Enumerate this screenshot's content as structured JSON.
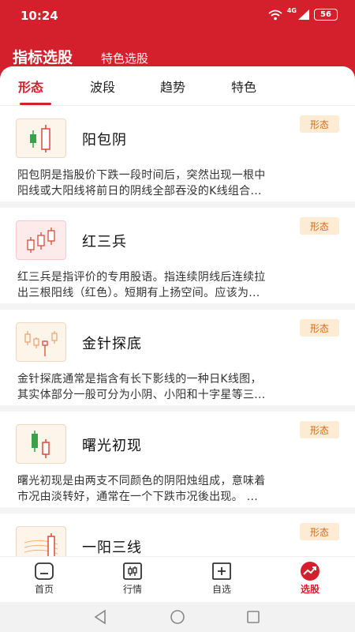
{
  "status": {
    "time": "10:24",
    "network": "4G",
    "battery": "56"
  },
  "top_nav": {
    "active": "指标选股",
    "other": "特色选股"
  },
  "tabs": [
    {
      "label": "形态"
    },
    {
      "label": "波段"
    },
    {
      "label": "趋势"
    },
    {
      "label": "特色"
    }
  ],
  "cards": [
    {
      "title": "阳包阴",
      "badge": "形态",
      "icon": "candlestick-bullish-engulfing-icon",
      "line1": "阳包阴是指股价下跌一段时间后，突然出现一根中",
      "line2": "阳线或大阳线将前日的阴线全部吞没的K线组合..."
    },
    {
      "title": "红三兵",
      "badge": "形态",
      "icon": "candlestick-three-soldiers-icon",
      "line1": "红三兵是指评价的专用股语。指连续阴线后连续拉",
      "line2": "出三根阳线（红色）。短期有上扬空间。应该为..."
    },
    {
      "title": "金针探底",
      "badge": "形态",
      "icon": "candlestick-hammer-icon",
      "line1": "金针探底通常是指含有长下影线的一种日K线图，",
      "line2": "其实体部分一般可分为小阴、小阳和十字星等三..."
    },
    {
      "title": "曙光初现",
      "badge": "形态",
      "icon": "candlestick-piercing-icon",
      "line1": "曙光初现是由两支不同颜色的阴阳烛组成，意味着",
      "line2": "市况由淡转好，通常在一个下跌市况後出现。 ..."
    },
    {
      "title": "一阳三线",
      "badge": "形态",
      "icon": "candlestick-one-yang-three-lines-icon",
      "line1": "",
      "line2": ""
    }
  ],
  "bottom_nav": [
    {
      "label": "首页",
      "icon": "home-icon"
    },
    {
      "label": "行情",
      "icon": "market-icon"
    },
    {
      "label": "自选",
      "icon": "watchlist-add-icon"
    },
    {
      "label": "选股",
      "icon": "stock-picker-icon"
    }
  ],
  "colors": {
    "brand": "#d41f2c",
    "badge_bg": "#fdebd4",
    "badge_text": "#d46a1c",
    "up": "#d94a3a",
    "down": "#3aa14a"
  }
}
